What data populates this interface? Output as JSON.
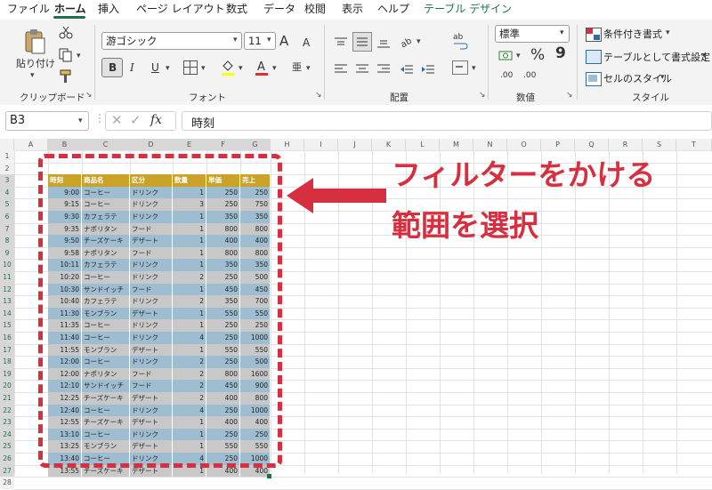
{
  "menu": {
    "tabs": [
      "ファイル",
      "ホーム",
      "挿入",
      "ページ レイアウト",
      "数式",
      "データ",
      "校閲",
      "表示",
      "ヘルプ",
      "テーブル デザイン"
    ]
  },
  "ribbon": {
    "clipboard": {
      "paste_label": "貼り付け",
      "group_label": "クリップボード"
    },
    "font": {
      "font_name": "游ゴシック",
      "font_size": "11",
      "bold": "B",
      "italic": "I",
      "underline": "U",
      "grow": "A",
      "shrink": "A",
      "group_label": "フォント",
      "phonetic": "亜"
    },
    "alignment": {
      "group_label": "配置"
    },
    "number": {
      "format": "標準",
      "percent": "%",
      "comma": "9",
      "dec_inc": ".00",
      "dec_dec": ".00",
      "group_label": "数値"
    },
    "styles": {
      "conditional": "条件付き書式",
      "as_table": "テーブルとして書式設定",
      "cell_styles": "セルのスタイル",
      "group_label": "スタイル"
    }
  },
  "formula_bar": {
    "name_box": "B3",
    "fx": "fx",
    "content": "時刻"
  },
  "columns": [
    "A",
    "B",
    "C",
    "D",
    "E",
    "F",
    "G",
    "H",
    "I",
    "J",
    "K",
    "L",
    "M",
    "N",
    "O",
    "P",
    "Q",
    "R",
    "S",
    "T"
  ],
  "rows": [
    "1",
    "2",
    "3",
    "4",
    "5",
    "6",
    "7",
    "8",
    "9",
    "10",
    "11",
    "12",
    "13",
    "14",
    "15",
    "16",
    "17",
    "18",
    "19",
    "20",
    "21",
    "22",
    "23",
    "24",
    "25",
    "26",
    "27",
    "28"
  ],
  "table": {
    "headers": [
      "時刻",
      "商品名",
      "区分",
      "数量",
      "単価",
      "売上"
    ],
    "rows": [
      [
        "9:00",
        "コーヒー",
        "ドリンク",
        "1",
        "250",
        "250"
      ],
      [
        "9:15",
        "コーヒー",
        "ドリンク",
        "3",
        "250",
        "750"
      ],
      [
        "9:30",
        "カフェラテ",
        "ドリンク",
        "1",
        "350",
        "350"
      ],
      [
        "9:35",
        "ナポリタン",
        "フード",
        "1",
        "800",
        "800"
      ],
      [
        "9:50",
        "チーズケーキ",
        "デザート",
        "1",
        "400",
        "400"
      ],
      [
        "9:58",
        "ナポリタン",
        "フード",
        "1",
        "800",
        "800"
      ],
      [
        "10:11",
        "カフェラテ",
        "ドリンク",
        "1",
        "350",
        "350"
      ],
      [
        "10:20",
        "コーヒー",
        "ドリンク",
        "2",
        "250",
        "500"
      ],
      [
        "10:30",
        "サンドイッチ",
        "フード",
        "1",
        "450",
        "450"
      ],
      [
        "10:40",
        "カフェラテ",
        "ドリンク",
        "2",
        "350",
        "700"
      ],
      [
        "11:30",
        "モンブラン",
        "デザート",
        "1",
        "550",
        "550"
      ],
      [
        "11:35",
        "コーヒー",
        "ドリンク",
        "1",
        "250",
        "250"
      ],
      [
        "11:40",
        "コーヒー",
        "ドリンク",
        "4",
        "250",
        "1000"
      ],
      [
        "11:55",
        "モンブラン",
        "デザート",
        "1",
        "550",
        "550"
      ],
      [
        "12:00",
        "コーヒー",
        "ドリンク",
        "2",
        "250",
        "500"
      ],
      [
        "12:00",
        "ナポリタン",
        "フード",
        "2",
        "800",
        "1600"
      ],
      [
        "12:10",
        "サンドイッチ",
        "フード",
        "2",
        "450",
        "900"
      ],
      [
        "12:25",
        "チーズケーキ",
        "デザート",
        "2",
        "400",
        "800"
      ],
      [
        "12:40",
        "コーヒー",
        "ドリンク",
        "4",
        "250",
        "1000"
      ],
      [
        "12:55",
        "チーズケーキ",
        "デザート",
        "1",
        "400",
        "400"
      ],
      [
        "13:10",
        "コーヒー",
        "ドリンク",
        "1",
        "250",
        "250"
      ],
      [
        "13:25",
        "モンブラン",
        "デザート",
        "1",
        "550",
        "550"
      ],
      [
        "13:40",
        "コーヒー",
        "ドリンク",
        "4",
        "250",
        "1000"
      ],
      [
        "13:55",
        "チーズケーキ",
        "デザート",
        "1",
        "400",
        "400"
      ]
    ]
  },
  "annotation": {
    "line1": "フィルターをかける",
    "line2": "範囲を選択"
  },
  "colors": {
    "accent": "#1e7145",
    "annotation": "#d62f3f",
    "header_fill": "#c9a227",
    "band_blue": "#9fbdd0",
    "band_gray": "#c8c8c8"
  }
}
